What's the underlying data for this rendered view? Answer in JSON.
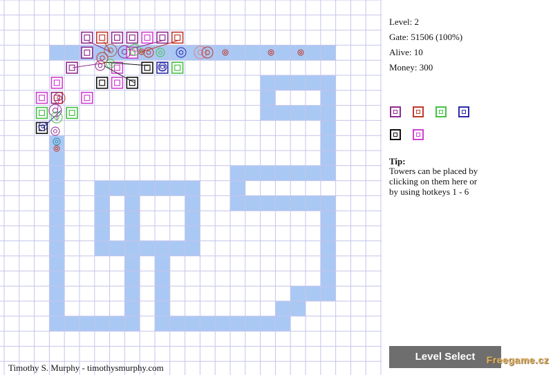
{
  "stats": {
    "level": "Level: 2",
    "gate": "Gate: 51506 (100%)",
    "alive": "Alive: 10",
    "money": "Money: 300"
  },
  "tower_picker": [
    {
      "name": "purple-tower",
      "color": "#8e2a8e"
    },
    {
      "name": "red-tower",
      "color": "#c0392b"
    },
    {
      "name": "green-tower",
      "color": "#44c044"
    },
    {
      "name": "blue-tower",
      "color": "#2a2aa8"
    },
    {
      "name": "black-tower",
      "color": "#111111"
    },
    {
      "name": "magenta-tower",
      "color": "#d040d0"
    }
  ],
  "tip": {
    "title": "Tip:",
    "lines": [
      "Towers can be placed by",
      "clicking on them here or",
      "by using hotkeys 1 - 6"
    ]
  },
  "level_select_label": "Level Select",
  "credit": "Timothy S. Murphy - timothysmurphy.com",
  "watermark": "Freegame.cz",
  "colors": {
    "grid": "#c4c4ec",
    "path": "#aac8f4",
    "button": "#6e6e6e"
  }
}
